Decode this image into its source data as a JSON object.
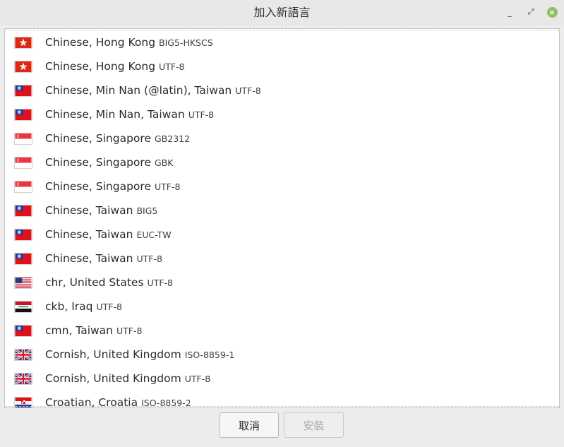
{
  "window": {
    "title": "加入新語言",
    "minimize_glyph": "_",
    "maximize_glyph": "⤢",
    "close_glyph": "×"
  },
  "languages": [
    {
      "name": "Chinese, Hong Kong",
      "encoding": "BIG5-HKSCS",
      "flag": "hk"
    },
    {
      "name": "Chinese, Hong Kong",
      "encoding": "UTF-8",
      "flag": "hk"
    },
    {
      "name": "Chinese, Min Nan (@latin), Taiwan",
      "encoding": "UTF-8",
      "flag": "tw"
    },
    {
      "name": "Chinese, Min Nan, Taiwan",
      "encoding": "UTF-8",
      "flag": "tw"
    },
    {
      "name": "Chinese, Singapore",
      "encoding": "GB2312",
      "flag": "sg"
    },
    {
      "name": "Chinese, Singapore",
      "encoding": "GBK",
      "flag": "sg"
    },
    {
      "name": "Chinese, Singapore",
      "encoding": "UTF-8",
      "flag": "sg"
    },
    {
      "name": "Chinese, Taiwan",
      "encoding": "BIG5",
      "flag": "tw"
    },
    {
      "name": "Chinese, Taiwan",
      "encoding": "EUC-TW",
      "flag": "tw"
    },
    {
      "name": "Chinese, Taiwan",
      "encoding": "UTF-8",
      "flag": "tw"
    },
    {
      "name": "chr, United States",
      "encoding": "UTF-8",
      "flag": "us"
    },
    {
      "name": "ckb, Iraq",
      "encoding": "UTF-8",
      "flag": "iq"
    },
    {
      "name": "cmn, Taiwan",
      "encoding": "UTF-8",
      "flag": "tw"
    },
    {
      "name": "Cornish, United Kingdom",
      "encoding": "ISO-8859-1",
      "flag": "gb"
    },
    {
      "name": "Cornish, United Kingdom",
      "encoding": "UTF-8",
      "flag": "gb"
    },
    {
      "name": "Croatian, Croatia",
      "encoding": "ISO-8859-2",
      "flag": "hr"
    }
  ],
  "buttons": {
    "cancel": "取消",
    "install": "安裝"
  },
  "colors": {
    "close_button": "#8fbf60",
    "background": "#ececec"
  }
}
